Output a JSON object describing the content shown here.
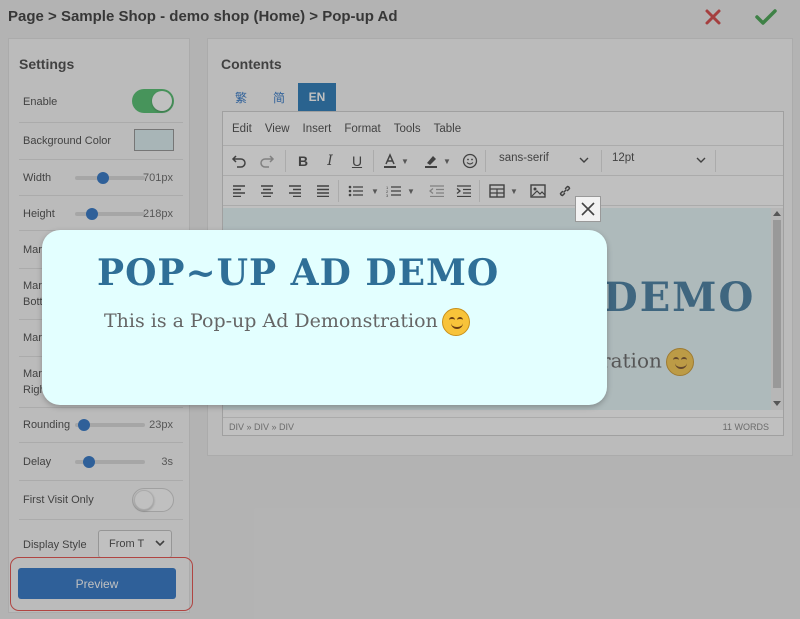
{
  "breadcrumb": "Page > Sample Shop - demo shop (Home) > Pop-up Ad",
  "actions": {
    "cancel_icon": "x-icon",
    "confirm_icon": "check-icon",
    "cancel_color": "#d32f2f",
    "confirm_color": "#2e9a3a"
  },
  "settings": {
    "title": "Settings",
    "enable_label": "Enable",
    "enable_on": true,
    "background_color_label": "Background Color",
    "background_color": "#d8eef0",
    "width_label": "Width",
    "width_value": "701px",
    "width_level": 0.35,
    "height_label": "Height",
    "height_value": "218px",
    "height_level": 0.2,
    "margin_label": "Mar",
    "margin_bottom_label_1": "Mar",
    "margin_bottom_label_2": "Bott",
    "margin_3_label": "Mar",
    "margin_right_label_1": "Mar",
    "margin_right_label_2": "Righ",
    "rounding_label": "Rounding",
    "rounding_value": "23px",
    "rounding_level": 0.05,
    "delay_label": "Delay",
    "delay_value": "3s",
    "delay_level": 0.15,
    "first_visit_label": "First Visit Only",
    "first_visit_on": false,
    "display_style_label": "Display Style",
    "display_style_value": "From T",
    "preview_label": "Preview"
  },
  "contents": {
    "title": "Contents",
    "tabs": [
      {
        "label": "繁",
        "active": false
      },
      {
        "label": "简",
        "active": false
      },
      {
        "label": "EN",
        "active": true
      }
    ],
    "menu": [
      "Edit",
      "View",
      "Insert",
      "Format",
      "Tools",
      "Table"
    ],
    "font_family": "sans-serif",
    "font_size": "12pt",
    "body_heading": "DEMO",
    "body_sub": "tration",
    "status_path": "DIV » DIV » DIV",
    "word_count": "11 WORDS"
  },
  "popup": {
    "heading": "POP~UP AD DEMO",
    "subtitle": "This is a Pop-up Ad Demonstration",
    "emoji_icon": "smiling-face-icon",
    "background": "#e3ffff"
  }
}
